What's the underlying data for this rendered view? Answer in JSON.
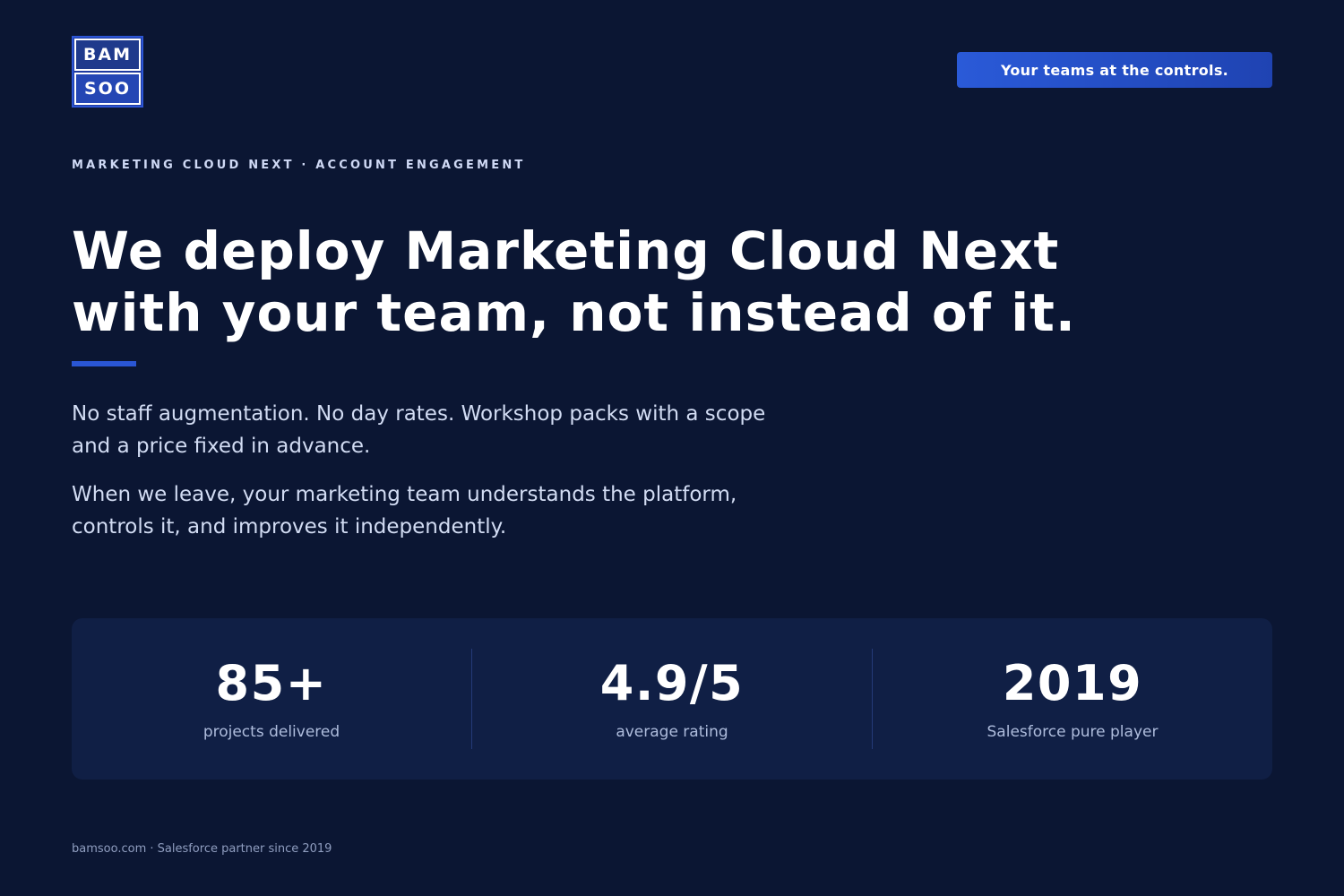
{
  "logo": {
    "top": "BAM",
    "bottom": "SOO"
  },
  "cta": {
    "label": "Your teams at the controls."
  },
  "eyebrow": "MARKETING CLOUD NEXT · ACCOUNT ENGAGEMENT",
  "headline": {
    "line1": "We deploy Marketing Cloud Next",
    "line2": "with your team, not instead of it."
  },
  "body": {
    "p1_line1": "No staff augmentation. No day rates. Workshop packs with a scope",
    "p1_line2": "and a price fixed in advance.",
    "p2_line1": "When we leave, your marketing team understands the platform,",
    "p2_line2": "controls it, and improves it independently."
  },
  "stats": [
    {
      "value": "85+",
      "label": "projects delivered"
    },
    {
      "value": "4.9/5",
      "label": "average rating"
    },
    {
      "value": "2019",
      "label": "Salesforce pure player"
    }
  ],
  "footer": "bamsoo.com · Salesforce partner since 2019",
  "colors": {
    "background": "#0b1633",
    "card": "#101f45",
    "accent": "#2a56d4"
  }
}
